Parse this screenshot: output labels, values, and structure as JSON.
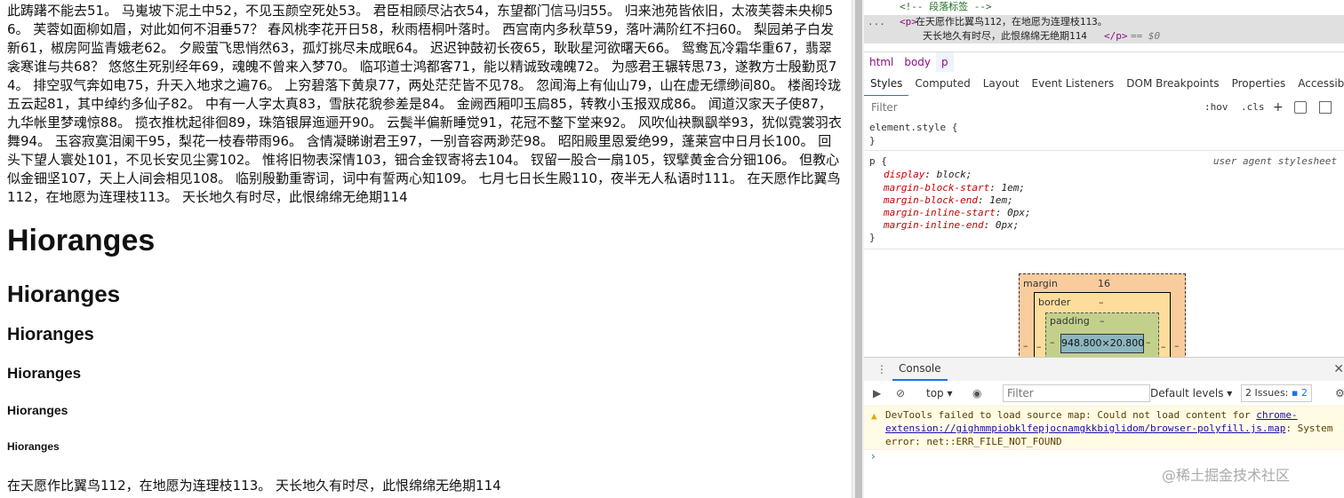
{
  "page": {
    "paragraph": "此踌躇不能去51。 马嵬坡下泥土中52，不见玉颜空死处53。 君臣相顾尽沾衣54，东望都门信马归55。 归来池苑皆依旧，太液芙蓉未央柳56。 芙蓉如面柳如眉，对此如何不泪垂57？ 春风桃李花开日58，秋雨梧桐叶落时。 西宫南内多秋草59，落叶满阶红不扫60。 梨园弟子白发新61，椒房阿监青娥老62。 夕殿萤飞思悄然63，孤灯挑尽未成眠64。 迟迟钟鼓初长夜65，耿耿星河欲曙天66。 鸳鸯瓦冷霜华重67，翡翠衾寒谁与共68？ 悠悠生死别经年69，魂魄不曾来入梦70。 临邛道士鸿都客71，能以精诚致魂魄72。 为感君王辗转思73，遂教方士殷勤觅74。 排空驭气奔如电75，升天入地求之遍76。 上穷碧落下黄泉77，两处茫茫皆不见78。 忽闻海上有仙山79，山在虚无缥缈间80。 楼阁玲珑五云起81，其中绰约多仙子82。 中有一人字太真83，雪肤花貌参差是84。 金阙西厢叩玉扃85，转教小玉报双成86。 闻道汉家天子使87，九华帐里梦魂惊88。 揽衣推枕起徘徊89，珠箔银屏迤逦开90。 云鬓半偏新睡觉91，花冠不整下堂来92。 风吹仙袂飘飖举93，犹似霓裳羽衣舞94。 玉容寂寞泪阑干95，梨花一枝春带雨96。 含情凝睇谢君王97，一别音容两渺茫98。 昭阳殿里恩爱绝99，蓬莱宫中日月长100。 回头下望人寰处101，不见长安见尘雾102。 惟将旧物表深情103，钿合金钗寄将去104。 钗留一股合一扇105，钗擘黄金合分钿106。 但教心似金钿坚107，天上人间会相见108。 临别殷勤重寄词，词中有誓两心知109。 七月七日长生殿110，夜半无人私语时111。 在天愿作比翼鸟112，在地愿为连理枝113。 天长地久有时尽，此恨绵绵无绝期114",
    "h1": "Hioranges",
    "h2": "Hioranges",
    "h3": "Hioranges",
    "h4": "Hioranges",
    "h5": "Hioranges",
    "h6": "Hioranges",
    "last_paragraph": "在天愿作比翼鸟112，在地愿为连理枝113。 天长地久有时尽，此恨绵绵无绝期114"
  },
  "devtools": {
    "dom": {
      "comment": "<!-- 段落标签 -->",
      "ellipsis": "...",
      "open_tag": "<p>",
      "line1_text": "在天愿作比翼鸟112，在地愿为连理枝113。",
      "line2_text": "天长地久有时尽，此恨绵绵无绝期114",
      "close_tag": "</p>",
      "eq": "== $0"
    },
    "breadcrumbs": [
      "html",
      "body",
      "p"
    ],
    "tabs": [
      "Styles",
      "Computed",
      "Layout",
      "Event Listeners",
      "DOM Breakpoints",
      "Properties",
      "Accessibility"
    ],
    "filter_placeholder": "Filter",
    "hov": ":hov",
    "cls": ".cls",
    "plus": "+",
    "styles": {
      "element_style": "element.style {",
      "close_brace": "}",
      "rule_selector": "p {",
      "ua_label": "user agent stylesheet",
      "decls": [
        {
          "prop": "display",
          "val": "block;"
        },
        {
          "prop": "margin-block-start",
          "val": "1em;"
        },
        {
          "prop": "margin-block-end",
          "val": "1em;"
        },
        {
          "prop": "margin-inline-start",
          "val": "0px;"
        },
        {
          "prop": "margin-inline-end",
          "val": "0px;"
        }
      ]
    },
    "box_model": {
      "margin_label": "margin",
      "margin_value": "16",
      "border_label": "border",
      "border_value": "–",
      "padding_label": "padding",
      "padding_value": "–",
      "content": "948.800×20.800",
      "dash": "–"
    },
    "console": {
      "tab": "Console",
      "context": "top",
      "filter_placeholder": "Filter",
      "levels": "Default levels",
      "issues": "2 Issues:",
      "issues_count": "2",
      "warning": "DevTools failed to load source map: Could not load content for ",
      "warning_link": "chrome-extension://gighmmpiobklfepjocnamgkkbiglidom/browser-polyfill.js.map",
      "warning_tail": ": System error: net::ERR_FILE_NOT_FOUND",
      "prompt": "›"
    },
    "watermark": "@稀土掘金技术社区"
  }
}
